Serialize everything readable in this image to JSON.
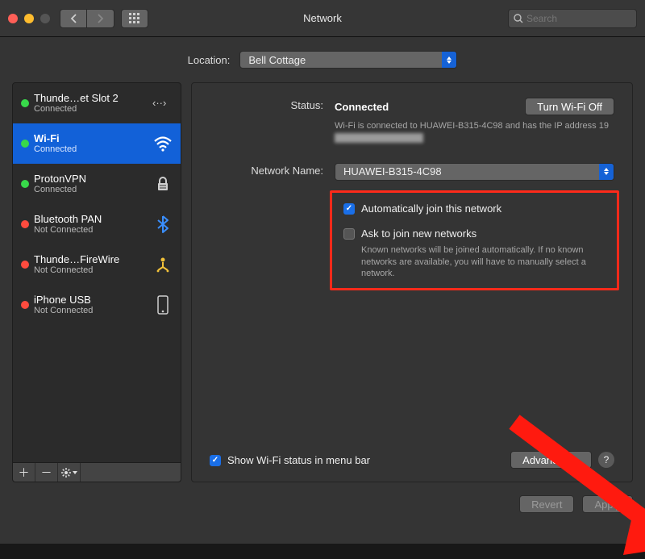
{
  "window": {
    "title": "Network"
  },
  "toolbar": {
    "search_placeholder": "Search"
  },
  "location": {
    "label": "Location:",
    "value": "Bell Cottage"
  },
  "sidebar": {
    "items": [
      {
        "name": "Thunde…et Slot 2",
        "status": "Connected",
        "dot": "green",
        "icon": "bridge"
      },
      {
        "name": "Wi-Fi",
        "status": "Connected",
        "dot": "green",
        "icon": "wifi",
        "selected": true
      },
      {
        "name": "ProtonVPN",
        "status": "Connected",
        "dot": "green",
        "icon": "lock"
      },
      {
        "name": "Bluetooth PAN",
        "status": "Not Connected",
        "dot": "red",
        "icon": "bluetooth"
      },
      {
        "name": "Thunde…FireWire",
        "status": "Not Connected",
        "dot": "red",
        "icon": "firewire"
      },
      {
        "name": "iPhone USB",
        "status": "Not Connected",
        "dot": "red",
        "icon": "phone"
      }
    ]
  },
  "detail": {
    "status_label": "Status:",
    "status_value": "Connected",
    "wifi_off_btn": "Turn Wi-Fi Off",
    "status_desc_prefix": "Wi-Fi is connected to HUAWEI-B315-4C98 and has the IP address 19",
    "network_name_label": "Network Name:",
    "network_name_value": "HUAWEI-B315-4C98",
    "auto_join_label": "Automatically join this network",
    "auto_join_checked": true,
    "ask_join_label": "Ask to join new networks",
    "ask_join_checked": false,
    "ask_join_desc": "Known networks will be joined automatically. If no known networks are available, you will have to manually select a network.",
    "menubar_label": "Show Wi-Fi status in menu bar",
    "menubar_checked": true,
    "advanced_btn": "Advanced…"
  },
  "footer": {
    "revert": "Revert",
    "apply": "Apply"
  }
}
